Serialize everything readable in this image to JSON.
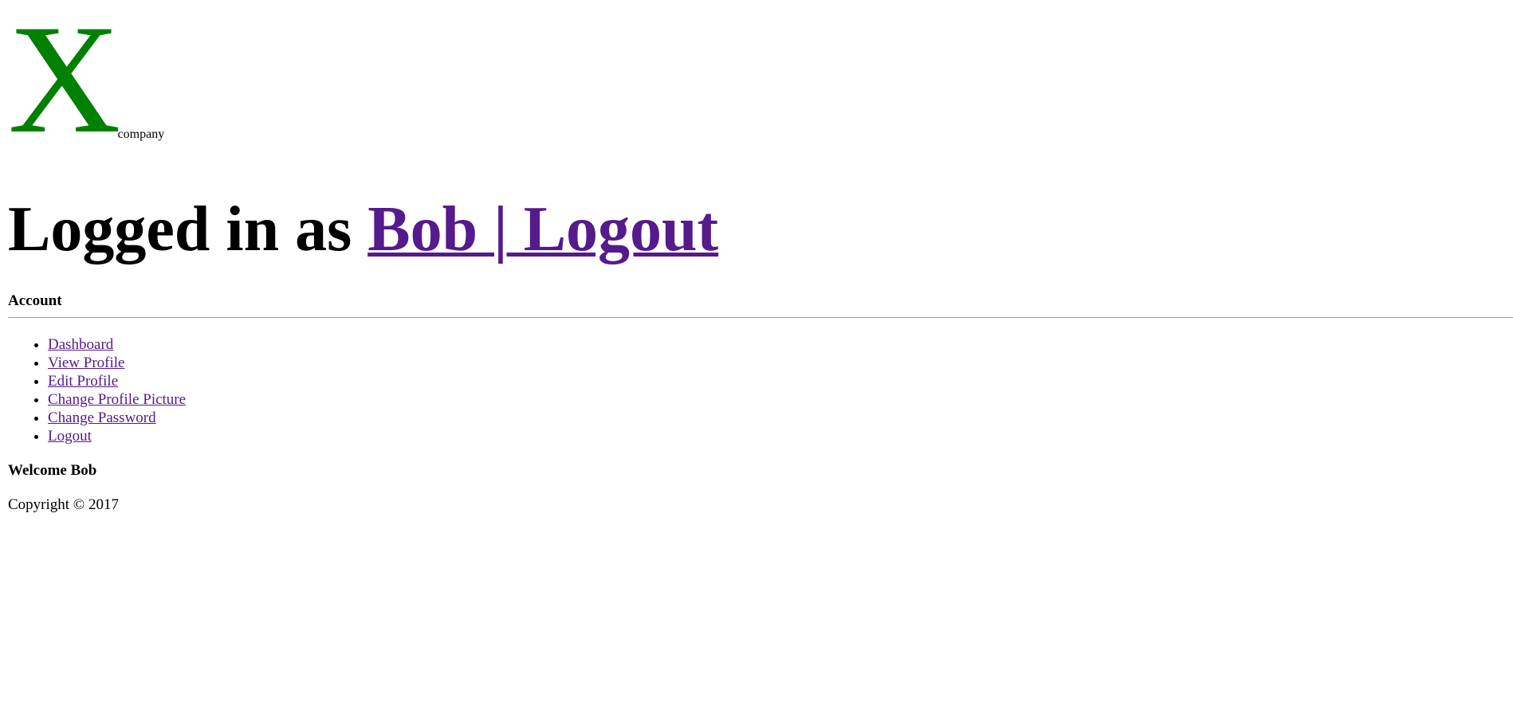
{
  "logo": {
    "mark": "X",
    "text": "company",
    "mark_color": "#008000"
  },
  "header": {
    "prefix": "Logged in as",
    "user_link": "Bob | Logout",
    "link_color": "#551a8b"
  },
  "account": {
    "heading": "Account",
    "items": [
      {
        "label": "Dashboard"
      },
      {
        "label": "View Profile"
      },
      {
        "label": "Edit Profile"
      },
      {
        "label": "Change Profile Picture"
      },
      {
        "label": "Change Password"
      },
      {
        "label": "Logout"
      }
    ]
  },
  "main": {
    "welcome": "Welcome Bob"
  },
  "footer": {
    "copyright": "Copyright © 2017"
  }
}
